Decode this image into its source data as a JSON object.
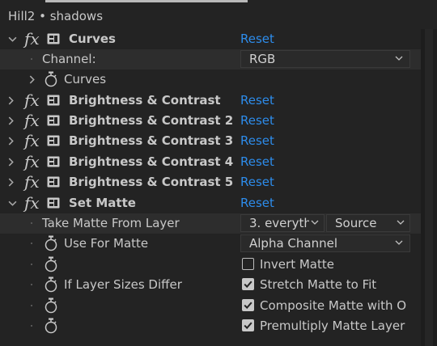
{
  "panel": {
    "title": "Hill2 • shadows"
  },
  "effects": [
    {
      "name": "Curves",
      "reset": "Reset"
    },
    {
      "name": "Brightness & Contrast",
      "reset": "Reset"
    },
    {
      "name": "Brightness & Contrast 2",
      "reset": "Reset"
    },
    {
      "name": "Brightness & Contrast 3",
      "reset": "Reset"
    },
    {
      "name": "Brightness & Contrast 4",
      "reset": "Reset"
    },
    {
      "name": "Brightness & Contrast 5",
      "reset": "Reset"
    },
    {
      "name": "Set Matte",
      "reset": "Reset"
    }
  ],
  "curves": {
    "channel_label": "Channel:",
    "channel_value": "RGB",
    "curves_label": "Curves"
  },
  "set_matte": {
    "take_matte_label": "Take Matte From Layer",
    "take_matte_layer": "3. everyth",
    "take_matte_source": "Source",
    "use_for_matte_label": "Use For Matte",
    "use_for_matte_value": "Alpha Channel",
    "invert_matte_label": "Invert Matte",
    "invert_matte_checked": false,
    "layer_sizes_label": "If Layer Sizes Differ",
    "stretch_label": "Stretch Matte to Fit",
    "stretch_checked": true,
    "composite_label": "Composite Matte with O",
    "composite_checked": true,
    "premultiply_label": "Premultiply Matte Layer",
    "premultiply_checked": true
  },
  "icons": {
    "expand": "chevron-right-icon",
    "collapse": "chevron-down-icon",
    "fx": "fx-icon",
    "effect_mask": "effect-mask-icon",
    "stopwatch": "stopwatch-icon",
    "dropdown": "chevron-down-icon",
    "checkbox": "checkbox-icon"
  },
  "colors": {
    "background": "#232323",
    "reset_link": "#2d8ceb",
    "text": "#c8c8c8"
  }
}
